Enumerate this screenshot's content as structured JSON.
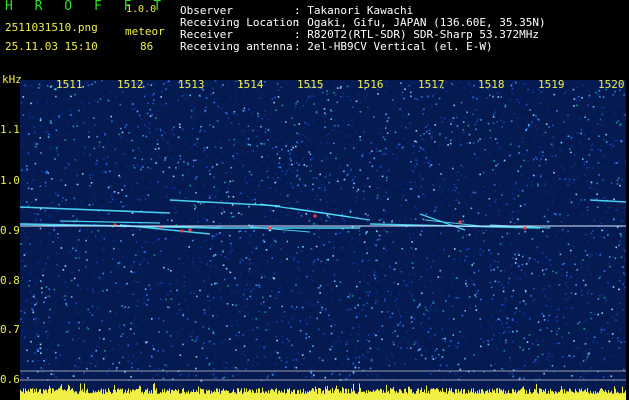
{
  "app": {
    "title": "H R O F F T",
    "version": "1.0.0",
    "filename": "2511031510.png",
    "datetime": "25.11.03 15:10",
    "mode": "meteor",
    "count": "86"
  },
  "info": [
    {
      "key": "Observer",
      "value": ": Takanori Kawachi"
    },
    {
      "key": "Receiving Location",
      "value": ": Ogaki, Gifu, JAPAN (136.60E, 35.35N)"
    },
    {
      "key": "Receiver",
      "value": ": R820T2(RTL-SDR) SDR-Sharp 53.372MHz"
    },
    {
      "key": "Receiving antenna",
      "value": ": 2el-HB9CV Vertical (el. E-W)"
    }
  ],
  "axis": {
    "y_unit": "kHz",
    "y_ticks": [
      "1.1",
      "1.0",
      "0.9",
      "0.8",
      "0.7",
      "0.6"
    ],
    "x_ticks": [
      "1511",
      "1512",
      "1513",
      "1514",
      "1515",
      "1516",
      "1517",
      "1518",
      "1519",
      "1520"
    ]
  },
  "colors": {
    "background": "#000000",
    "label_yellow": "#f0ef44",
    "title_green": "#28e028",
    "noise_base": "#061a52",
    "trace_cyan": "#4fe3ff",
    "trace_red": "#ff3a3a",
    "level_yellow": "#f0ef44"
  }
}
